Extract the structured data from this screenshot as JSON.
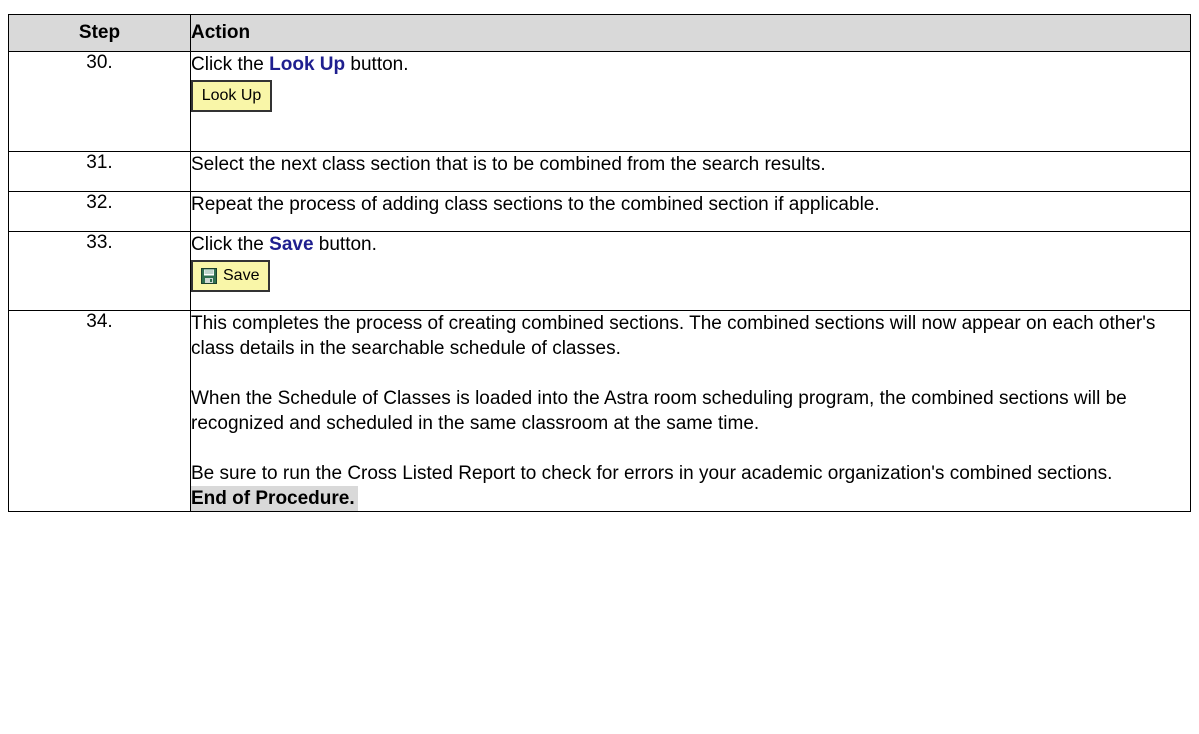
{
  "table": {
    "headers": {
      "step": "Step",
      "action": "Action"
    },
    "rows": [
      {
        "step": "30.",
        "text_before": "Click the ",
        "highlight": "Look Up",
        "text_after": " button.",
        "button_label": "Look Up"
      },
      {
        "step": "31.",
        "text": "Select the next class section that is to be combined from the search results."
      },
      {
        "step": "32.",
        "text": "Repeat the process of adding class sections to the combined section if applicable."
      },
      {
        "step": "33.",
        "text_before": "Click the ",
        "highlight": "Save",
        "text_after": " button.",
        "button_label": "Save",
        "button_icon": "floppy-disk-icon"
      },
      {
        "step": "34.",
        "para1": "This completes the process of creating combined sections.  The combined sections will now appear on each other's class details in the searchable schedule of classes.",
        "para2": "When the Schedule of Classes is loaded into the Astra room scheduling program, the combined sections will be recognized and scheduled in the same classroom at the same time.",
        "para3": "Be sure to run the Cross Listed Report to check for errors in your academic organization's combined sections.",
        "end": "End of Procedure."
      }
    ]
  },
  "colors": {
    "header_bg": "#d9d9d9",
    "highlight_text": "#1f1f8f",
    "button_bg": "#f9f6a8"
  }
}
